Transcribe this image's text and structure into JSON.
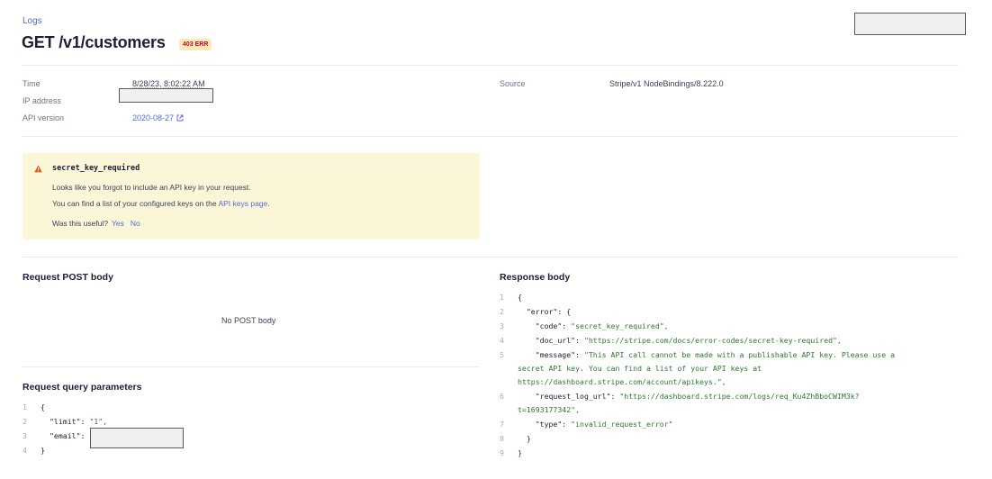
{
  "breadcrumb": "Logs",
  "title": "GET /v1/customers",
  "status_badge": "403 ERR",
  "meta": {
    "time_label": "Time",
    "time_value": "8/28/23, 8:02:22 AM",
    "ip_label": "IP address",
    "api_version_label": "API version",
    "api_version_value": "2020-08-27",
    "source_label": "Source",
    "source_value": "Stripe/v1 NodeBindings/8.222.0"
  },
  "alert": {
    "code": "secret_key_required",
    "line1": "Looks like you forgot to include an API key in your request.",
    "line2_prefix": "You can find a list of your configured keys on the ",
    "line2_link": "API keys page",
    "line2_suffix": ".",
    "feedback_question": "Was this useful?",
    "yes": "Yes",
    "no": "No",
    "icon": "warning-triangle-icon",
    "color": "#fcf6d9"
  },
  "request_body": {
    "title": "Request POST body",
    "empty": "No POST body"
  },
  "query_params": {
    "title": "Request query parameters",
    "line_numbers": [
      "1",
      "2",
      "3",
      "4"
    ],
    "open": "{",
    "limit_key": "\"limit\": ",
    "limit_value": "\"1\",",
    "email_key": "\"email\": ",
    "close": "}"
  },
  "response_body": {
    "title": "Response body",
    "line_numbers": [
      "1",
      "2",
      "3",
      "4",
      "5",
      "6",
      "7",
      "8",
      "9"
    ],
    "l1": "{",
    "l2": "  \"error\": {",
    "code_key": "    \"code\": ",
    "code_val": "\"secret_key_required\",",
    "doc_key": "    \"doc_url\": ",
    "doc_val": "\"https://stripe.com/docs/error-codes/secret-key-required\",",
    "msg_key": "    \"message\": ",
    "msg_val_a": "\"This API call cannot be made with a publishable API key. Please use a",
    "msg_val_b": "secret API key. You can find a list of your API keys at",
    "msg_val_c": "https://dashboard.stripe.com/account/apikeys.\",",
    "req_key": "    \"request_log_url\": ",
    "req_val_a": "\"https://dashboard.stripe.com/logs/req_Ku4ZhBboCWIM3k?",
    "req_val_b": "t=1693177342\",",
    "type_key": "    \"type\": ",
    "type_val": "\"invalid_request_error\"",
    "l8": "  }",
    "l9": "}"
  }
}
